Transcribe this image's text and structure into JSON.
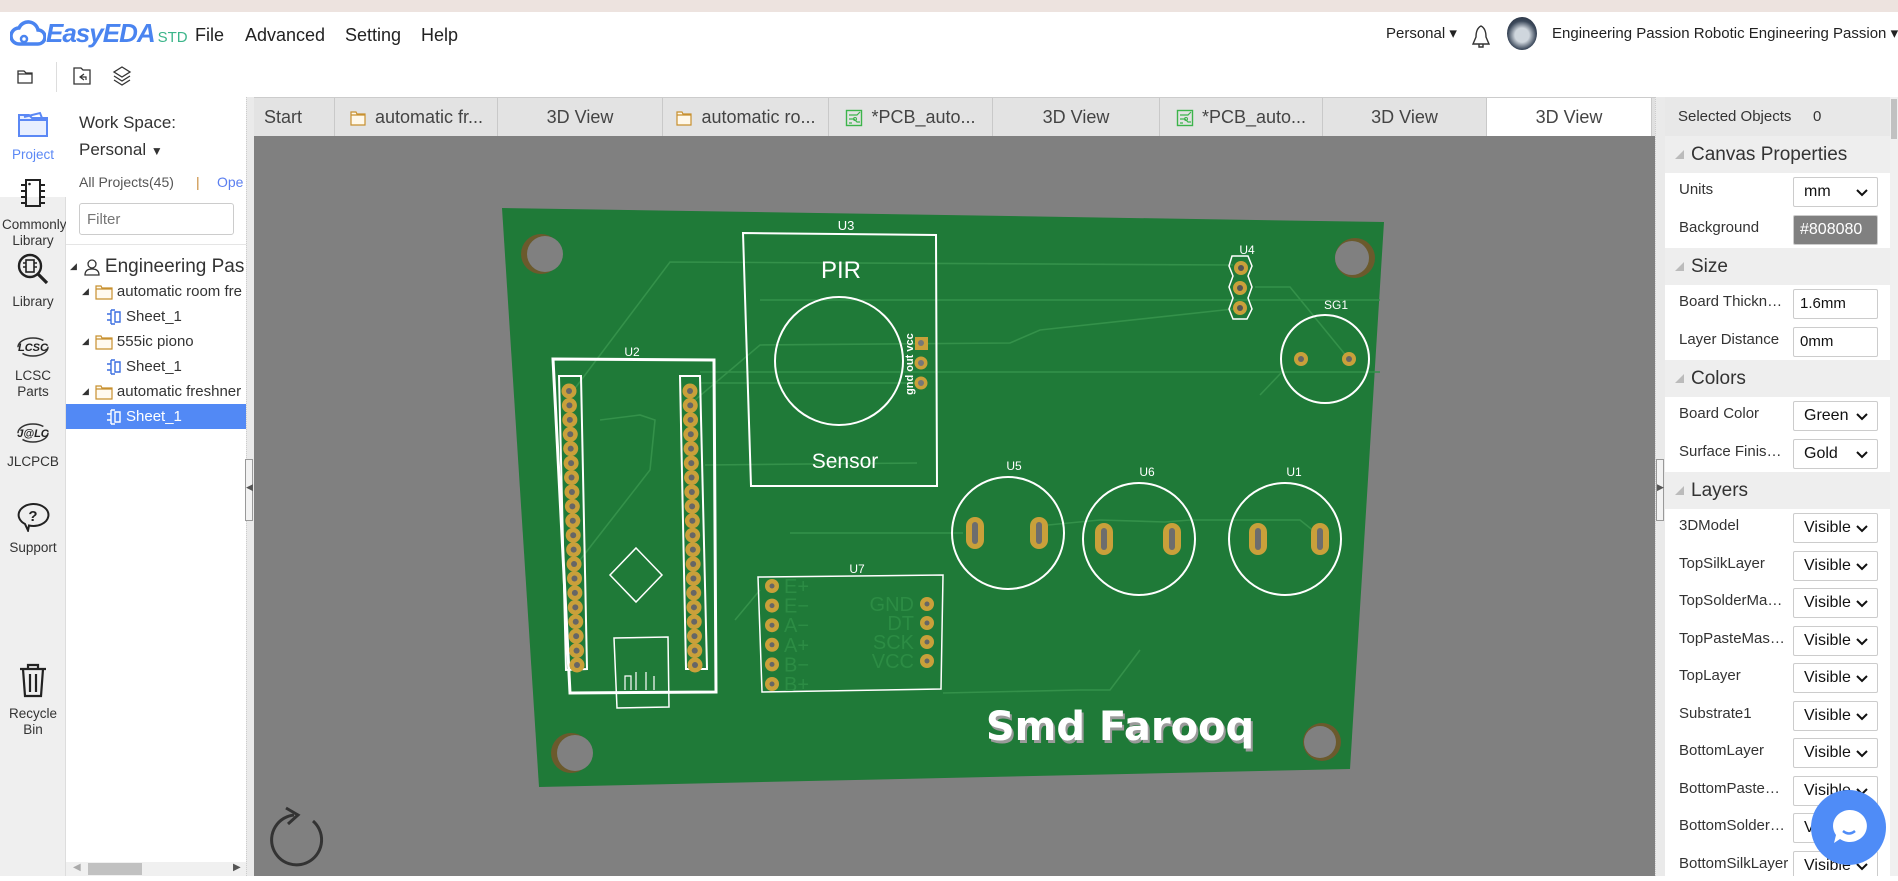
{
  "app": {
    "brand": "EasyEDA",
    "edition": "STD",
    "accent": "#4a84f0"
  },
  "menu": [
    "File",
    "Advanced",
    "Setting",
    "Help"
  ],
  "header": {
    "workspace": "Personal",
    "user": "Engineering Passion Robotic Engineering Passion"
  },
  "toolbar": {
    "icons": [
      "new-project-icon",
      "open-history-icon",
      "layers-icon"
    ]
  },
  "tabs": [
    {
      "label": "Start",
      "icon": ""
    },
    {
      "label": "automatic fr...",
      "icon": "folder"
    },
    {
      "label": "3D View",
      "icon": ""
    },
    {
      "label": "automatic ro...",
      "icon": "folder"
    },
    {
      "label": "*PCB_auto...",
      "icon": "pcb"
    },
    {
      "label": "3D View",
      "icon": ""
    },
    {
      "label": "*PCB_auto...",
      "icon": "pcb"
    },
    {
      "label": "3D View",
      "icon": ""
    },
    {
      "label": "3D View",
      "icon": "",
      "active": true
    }
  ],
  "iconbar": [
    {
      "label": "Project",
      "icon": "folder-icon",
      "active": true
    },
    {
      "label": "Commonly Library",
      "icon": "chip-icon"
    },
    {
      "label": "Library",
      "icon": "library-search-icon"
    },
    {
      "label": "LCSC Parts",
      "icon": "lcsc-logo-icon",
      "logo_text": "LCSC"
    },
    {
      "label": "JLCPCB",
      "icon": "jlc-logo-icon",
      "logo_text": "J@LC"
    },
    {
      "label": "Support",
      "icon": "help-bubble-icon"
    },
    {
      "label": "Recycle Bin",
      "icon": "trash-icon"
    }
  ],
  "leftpanel": {
    "workspace_label": "Work Space:",
    "workspace_value": "Personal",
    "all_projects": "All Projects(45)",
    "separator": "|",
    "open_link": "Ope",
    "filter_placeholder": "Filter",
    "tree": [
      {
        "label": "Engineering Pas",
        "level": 0,
        "type": "user"
      },
      {
        "label": "automatic room fre",
        "level": 1,
        "type": "folder"
      },
      {
        "label": "Sheet_1",
        "level": 2,
        "type": "sheet"
      },
      {
        "label": "555ic piono",
        "level": 1,
        "type": "folder"
      },
      {
        "label": "Sheet_1",
        "level": 2,
        "type": "sheet"
      },
      {
        "label": "automatic freshner",
        "level": 1,
        "type": "folder"
      },
      {
        "label": "Sheet_1",
        "level": 2,
        "type": "sheet",
        "selected": true
      }
    ]
  },
  "rightpanel": {
    "selected_objects_label": "Selected Objects",
    "selected_objects_count": "0",
    "sections": [
      {
        "title": "Canvas Properties",
        "rows": [
          {
            "label": "Units",
            "value": "mm",
            "kind": "select"
          },
          {
            "label": "Background",
            "value": "#808080",
            "kind": "color"
          }
        ]
      },
      {
        "title": "Size",
        "rows": [
          {
            "label": "Board Thickn…",
            "value": "1.6mm",
            "kind": "input"
          },
          {
            "label": "Layer Distance",
            "value": "0mm",
            "kind": "input"
          }
        ]
      },
      {
        "title": "Colors",
        "rows": [
          {
            "label": "Board Color",
            "value": "Green",
            "kind": "select"
          },
          {
            "label": "Surface Finis…",
            "value": "Gold",
            "kind": "select"
          }
        ]
      },
      {
        "title": "Layers",
        "rows": [
          {
            "label": "3DModel",
            "value": "Visible",
            "kind": "select"
          },
          {
            "label": "TopSilkLayer",
            "value": "Visible",
            "kind": "select"
          },
          {
            "label": "TopSolderMa…",
            "value": "Visible",
            "kind": "select"
          },
          {
            "label": "TopPasteMas…",
            "value": "Visible",
            "kind": "select"
          },
          {
            "label": "TopLayer",
            "value": "Visible",
            "kind": "select"
          },
          {
            "label": "Substrate1",
            "value": "Visible",
            "kind": "select"
          },
          {
            "label": "BottomLayer",
            "value": "Visible",
            "kind": "select"
          },
          {
            "label": "BottomPaste…",
            "value": "Visible",
            "kind": "select"
          },
          {
            "label": "BottomSolder…",
            "value": "Visible",
            "kind": "select"
          },
          {
            "label": "BottomSilkLayer",
            "value": "Visible",
            "kind": "select"
          }
        ]
      }
    ]
  },
  "board": {
    "color": "#1f7a38",
    "silk_color": "#ffffff",
    "pad_color": "#c9a03a",
    "canvas_background": "#808080",
    "designators": {
      "u1": "U1",
      "u2": "U2",
      "u3": "U3",
      "u4": "U4",
      "u5": "U5",
      "u6": "U6",
      "u7": "U7",
      "sg1": "SG1"
    },
    "u3_text": {
      "top": "PIR",
      "bottom": "Sensor",
      "pins": "gnd out vcc"
    },
    "u7_left_pins": [
      "E+",
      "E−",
      "A−",
      "A+",
      "B−",
      "B+"
    ],
    "u7_right_pins": [
      "GND",
      "DT",
      "SCK",
      "VCC"
    ],
    "signature": "Smd Farooq"
  }
}
